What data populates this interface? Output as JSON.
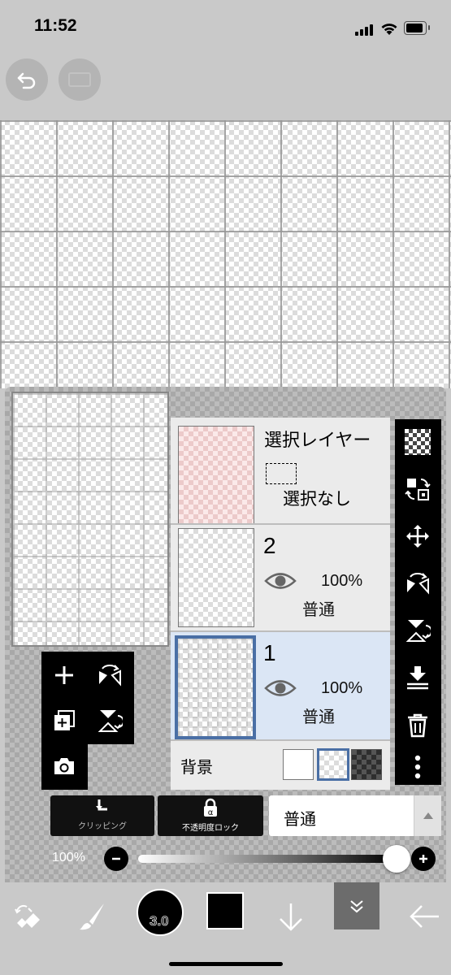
{
  "status_bar": {
    "time": "11:52"
  },
  "layers_panel": {
    "selection_layer": {
      "title": "選択レイヤー",
      "state": "選択なし"
    },
    "layers": [
      {
        "number": "2",
        "opacity": "100%",
        "blend": "普通",
        "selected": false
      },
      {
        "number": "1",
        "opacity": "100%",
        "blend": "普通",
        "selected": true
      }
    ],
    "background": {
      "label": "背景",
      "options": [
        "white",
        "transparent",
        "dark-checker"
      ],
      "selected": "transparent"
    },
    "buttons": {
      "clipping": "クリッピング",
      "alpha_lock": "不透明度ロック"
    },
    "blend_mode": "普通",
    "opacity": {
      "value": "100%",
      "level": 1.0
    }
  },
  "brush": {
    "size": "3.0"
  },
  "colors": {
    "accent": "#4a6fa5",
    "selected_row": "#dbe6f5",
    "toolbar": "#c9c9c9"
  }
}
